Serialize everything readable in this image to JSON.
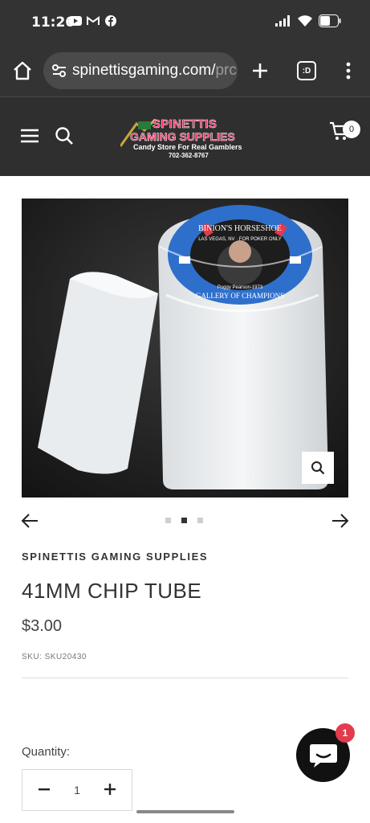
{
  "status_bar": {
    "time": "11:26"
  },
  "browser": {
    "url_main": "spinettisgaming.com/",
    "url_fade": "prc",
    "tabs_label": ":D"
  },
  "header": {
    "logo_line1": "SPINETTIS",
    "logo_line2": "GAMING SUPPLIES",
    "logo_tagline": "Candy Store For Real Gamblers",
    "logo_phone": "702-362-8767",
    "cart_count": "0"
  },
  "product": {
    "vendor": "SPINETTIS GAMING SUPPLIES",
    "title": "41MM CHIP TUBE",
    "price": "$3.00",
    "sku": "SKU: SKU20430",
    "quantity_label": "Quantity:",
    "quantity_value": "1",
    "chip_text_top": "BINION'S HORSESHOE",
    "chip_text_sub": "LAS VEGAS, NV · FOR POKER ONLY",
    "chip_text_name": "Puggy Pearson-1973",
    "chip_text_bottom": "GALLERY OF CHAMPIONS"
  },
  "carousel": {
    "slide_count": 3,
    "active_index": 1
  },
  "chat": {
    "badge": "1"
  },
  "colors": {
    "header_bg": "#2f2f2f",
    "statusbar_bg": "#333333",
    "brand_pink": "#e8245a",
    "chip_blue": "#2f6fcc",
    "badge_red": "#e33a4c"
  }
}
